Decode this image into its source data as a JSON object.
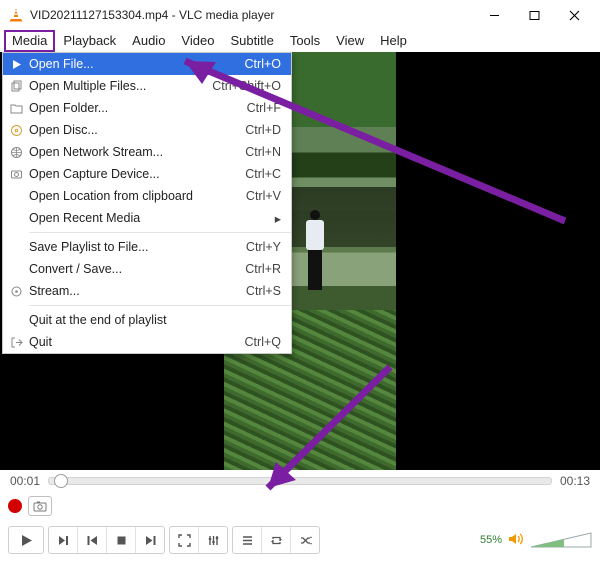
{
  "window": {
    "title": "VID20211127153304.mp4 - VLC media player"
  },
  "menubar": [
    "Media",
    "Playback",
    "Audio",
    "Video",
    "Subtitle",
    "Tools",
    "View",
    "Help"
  ],
  "dropdown": {
    "items": [
      {
        "icon": "play-file",
        "label": "Open File...",
        "shortcut": "Ctrl+O",
        "hi": true
      },
      {
        "icon": "files",
        "label": "Open Multiple Files...",
        "shortcut": "Ctrl+Shift+O"
      },
      {
        "icon": "folder",
        "label": "Open Folder...",
        "shortcut": "Ctrl+F"
      },
      {
        "icon": "disc",
        "label": "Open Disc...",
        "shortcut": "Ctrl+D"
      },
      {
        "icon": "network",
        "label": "Open Network Stream...",
        "shortcut": "Ctrl+N"
      },
      {
        "icon": "capture",
        "label": "Open Capture Device...",
        "shortcut": "Ctrl+C"
      },
      {
        "icon": "",
        "label": "Open Location from clipboard",
        "shortcut": "Ctrl+V"
      },
      {
        "icon": "",
        "label": "Open Recent Media",
        "shortcut": "",
        "submenu": true
      },
      {
        "sep": true
      },
      {
        "icon": "",
        "label": "Save Playlist to File...",
        "shortcut": "Ctrl+Y"
      },
      {
        "icon": "",
        "label": "Convert / Save...",
        "shortcut": "Ctrl+R"
      },
      {
        "icon": "stream",
        "label": "Stream...",
        "shortcut": "Ctrl+S"
      },
      {
        "sep": true
      },
      {
        "icon": "",
        "label": "Quit at the end of playlist",
        "shortcut": ""
      },
      {
        "icon": "quit",
        "label": "Quit",
        "shortcut": "Ctrl+Q"
      }
    ]
  },
  "time": {
    "current": "00:01",
    "total": "00:13"
  },
  "volume": {
    "percent": "55%"
  }
}
